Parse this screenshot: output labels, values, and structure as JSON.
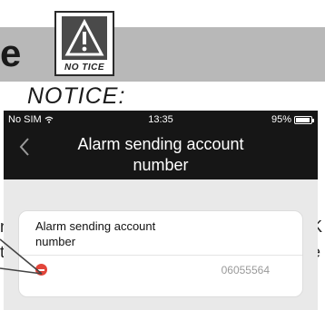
{
  "doc": {
    "big_letter": "e",
    "notice_icon_label": "NO TICE",
    "notice_heading": "NOTICE:",
    "edge_fragments": [
      "U",
      "n",
      "K",
      "t",
      "e"
    ]
  },
  "status_bar": {
    "carrier": "No SIM",
    "time": "13:35",
    "battery": "95%",
    "battery_level": 0.95
  },
  "header": {
    "back_icon": "chevron-left-icon",
    "title": "Alarm sending account number"
  },
  "card": {
    "label": "Alarm sending account number",
    "remove_icon": "minus-circle-icon",
    "value": "06055564"
  },
  "colors": {
    "band": "#b8b8b8",
    "header_bg": "#161616",
    "remove_red": "#e2453a"
  }
}
